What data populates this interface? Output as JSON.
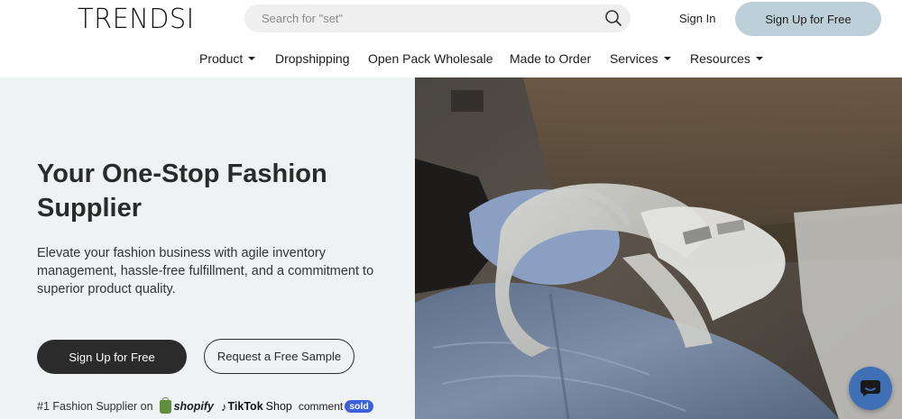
{
  "header": {
    "logo": "TRENDSI",
    "search_placeholder": "Search for \"set\"",
    "sign_in": "Sign In",
    "sign_up": "Sign Up for Free"
  },
  "nav": {
    "items": [
      {
        "label": "Product",
        "dropdown": true
      },
      {
        "label": "Dropshipping",
        "dropdown": false
      },
      {
        "label": "Open Pack Wholesale",
        "dropdown": false
      },
      {
        "label": "Made to Order",
        "dropdown": false
      },
      {
        "label": "Services",
        "dropdown": true
      },
      {
        "label": "Resources",
        "dropdown": true
      }
    ]
  },
  "hero": {
    "title": "Your One-Stop Fashion Supplier",
    "subtitle": "Elevate your fashion business with agile inventory management, hassle-free fulfillment, and a commitment to superior product quality.",
    "cta_primary": "Sign Up for Free",
    "cta_secondary": "Request a Free Sample",
    "partners_label": "#1 Fashion Supplier on",
    "partner_shopify": "shopify",
    "partner_tiktok": "TikTok",
    "partner_tiktok_shop": "Shop",
    "partner_comment": "comment",
    "partner_sold": "sold"
  },
  "icons": {
    "search": "search-icon",
    "chat": "chat-icon",
    "caret": "chevron-down-icon"
  },
  "colors": {
    "sign_up_bg": "#bdd0da",
    "hero_bg": "#eef2f3",
    "primary_button": "#2b2b2b",
    "chat_button": "#3f6fb5",
    "sold_badge": "#3b61d8"
  }
}
